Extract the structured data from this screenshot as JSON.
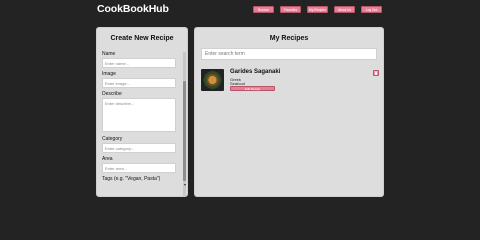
{
  "app": {
    "title": "CookBookHub"
  },
  "nav": [
    {
      "label": "Browse"
    },
    {
      "label": "Favorites"
    },
    {
      "label": "My Recipes"
    },
    {
      "label": "About Us"
    },
    {
      "label": "Log Out"
    }
  ],
  "create": {
    "title": "Create New Recipe",
    "fields": {
      "name": {
        "label": "Name",
        "placeholder": "Enter name..."
      },
      "image": {
        "label": "Image",
        "placeholder": "Enter image..."
      },
      "describe": {
        "label": "Describe",
        "placeholder": "Enter describe..."
      },
      "category": {
        "label": "Category",
        "placeholder": "Enter category..."
      },
      "area": {
        "label": "Area",
        "placeholder": "Enter area..."
      },
      "tags": {
        "label": "Tags (e.g. \"Vegan, Pasta\")"
      }
    }
  },
  "my_recipes": {
    "title": "My Recipes",
    "search_placeholder": "Enter search term",
    "items": [
      {
        "name": "Garides Saganaki",
        "area": "Greek",
        "category": "Seafood",
        "edit_label": "Edit Recipe"
      }
    ]
  },
  "colors": {
    "accent": "#e87e93",
    "background": "#232323",
    "panel": "#dddddd"
  }
}
